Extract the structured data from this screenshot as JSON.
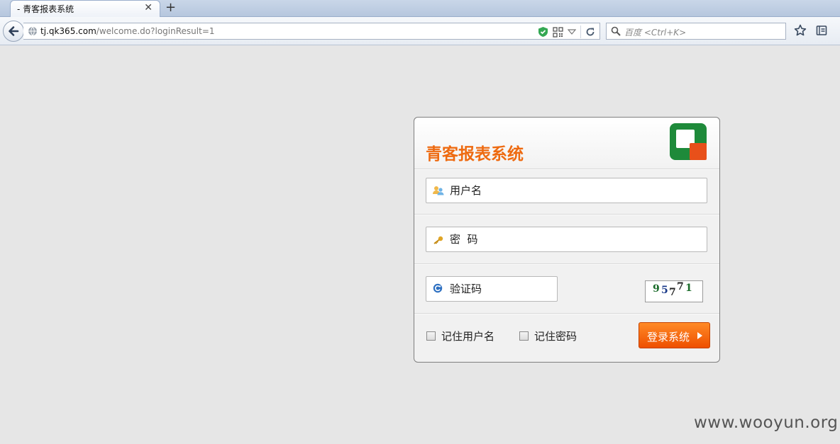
{
  "browser": {
    "tab_title": "- 青客报表系统",
    "new_tab_symbol": "+",
    "close_symbol": "✕",
    "url_host": "tj.qk365.com",
    "url_path": "/welcome.do?loginResult=1",
    "search_placeholder": "百度 <Ctrl+K>"
  },
  "login": {
    "app_title": "青客报表系统",
    "username_placeholder": "用户名",
    "password_placeholder": "密  码",
    "captcha_placeholder": "验证码",
    "captcha_digits": [
      "9",
      "5",
      "7",
      "7",
      "1"
    ],
    "remember_username": "记住用户名",
    "remember_password": "记住密码",
    "login_button": "登录系统"
  },
  "watermark": "www.wooyun.org",
  "colors": {
    "accent": "#ee6a10",
    "logo_green": "#1e8a3a",
    "logo_orange": "#e8501a",
    "page_bg": "#e6e6e6"
  }
}
